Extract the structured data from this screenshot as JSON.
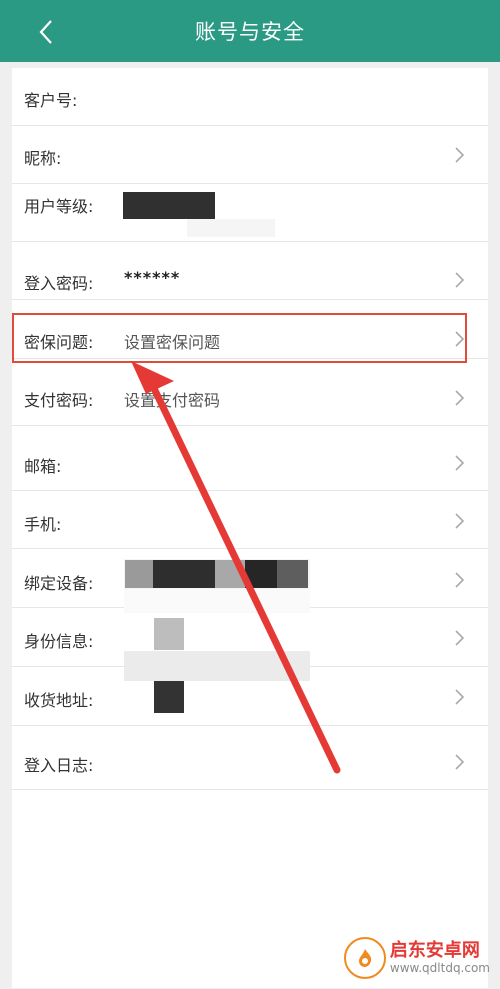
{
  "header": {
    "title": "账号与安全"
  },
  "rows": {
    "customer_id": {
      "label": "客户号:"
    },
    "nickname": {
      "label": "昵称:"
    },
    "user_level": {
      "label": "用户等级:"
    },
    "login_password": {
      "label": "登入密码:",
      "value": "******"
    },
    "security_question": {
      "label": "密保问题:",
      "value": "设置密保问题"
    },
    "payment_password": {
      "label": "支付密码:",
      "value": "设置支付密码"
    },
    "email": {
      "label": "邮箱:"
    },
    "phone": {
      "label": "手机:"
    },
    "bound_devices": {
      "label": "绑定设备:"
    },
    "identity_info": {
      "label": "身份信息:"
    },
    "shipping_address": {
      "label": "收货地址:"
    },
    "login_log": {
      "label": "登入日志:"
    }
  },
  "annotation": {
    "highlight_color": "#e04b3b",
    "arrow_color": "#e53935"
  },
  "watermark": {
    "title": "启东安卓网",
    "url": "www.qdltdq.com"
  },
  "colors": {
    "accent": "#2a9a84"
  }
}
